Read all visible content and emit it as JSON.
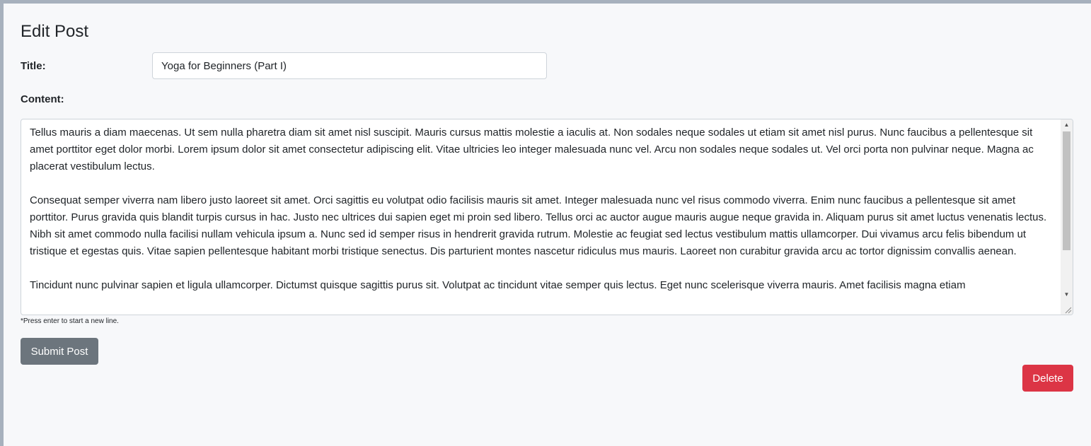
{
  "page": {
    "title": "Edit Post"
  },
  "form": {
    "title_label": "Title:",
    "title_value": "Yoga for Beginners (Part I)",
    "content_label": "Content:",
    "content_value": "Tellus mauris a diam maecenas. Ut sem nulla pharetra diam sit amet nisl suscipit. Mauris cursus mattis molestie a iaculis at. Non sodales neque sodales ut etiam sit amet nisl purus. Nunc faucibus a pellentesque sit amet porttitor eget dolor morbi. Lorem ipsum dolor sit amet consectetur adipiscing elit. Vitae ultricies leo integer malesuada nunc vel. Arcu non sodales neque sodales ut. Vel orci porta non pulvinar neque. Magna ac placerat vestibulum lectus.\n\nConsequat semper viverra nam libero justo laoreet sit amet. Orci sagittis eu volutpat odio facilisis mauris sit amet. Integer malesuada nunc vel risus commodo viverra. Enim nunc faucibus a pellentesque sit amet porttitor. Purus gravida quis blandit turpis cursus in hac. Justo nec ultrices dui sapien eget mi proin sed libero. Tellus orci ac auctor augue mauris augue neque gravida in. Aliquam purus sit amet luctus venenatis lectus. Nibh sit amet commodo nulla facilisi nullam vehicula ipsum a. Nunc sed id semper risus in hendrerit gravida rutrum. Molestie ac feugiat sed lectus vestibulum mattis ullamcorper. Dui vivamus arcu felis bibendum ut tristique et egestas quis. Vitae sapien pellentesque habitant morbi tristique senectus. Dis parturient montes nascetur ridiculus mus mauris. Laoreet non curabitur gravida arcu ac tortor dignissim convallis aenean.\n\nTincidunt nunc pulvinar sapien et ligula ullamcorper. Dictumst quisque sagittis purus sit. Volutpat ac tincidunt vitae semper quis lectus. Eget nunc scelerisque viverra mauris. Amet facilisis magna etiam",
    "content_hint": "*Press enter to start a new line."
  },
  "buttons": {
    "submit_label": "Submit Post",
    "delete_label": "Delete"
  },
  "icons": {
    "scroll_up": "scroll-up-arrow-icon",
    "scroll_down": "scroll-down-arrow-icon",
    "resize": "resize-grip-icon"
  },
  "colors": {
    "page_background": "#f7f8fa",
    "outer_frame": "#a7b1bd",
    "submit_button": "#6c757d",
    "delete_button": "#dc3545",
    "input_border": "#ced4da",
    "text": "#212529"
  }
}
